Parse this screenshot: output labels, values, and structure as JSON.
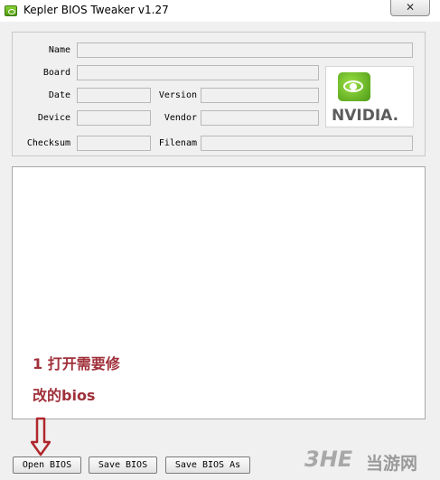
{
  "window": {
    "title": "Kepler BIOS Tweaker v1.27",
    "close_glyph": "✕"
  },
  "info": {
    "name_label": "Name",
    "board_label": "Board",
    "date_label": "Date",
    "version_label": "Version",
    "device_label": "Device",
    "vendor_label": "Vendor",
    "checksum_label": "Checksum",
    "filename_label": "Filenam",
    "name_value": "",
    "board_value": "",
    "date_value": "",
    "version_value": "",
    "device_value": "",
    "vendor_value": "",
    "checksum_value": "",
    "filename_value": ""
  },
  "logo": {
    "text": "NVIDIA.",
    "icon": "nvidia-eye-icon"
  },
  "annotation": {
    "line1": "1 打开需要修",
    "line2": "改的bios",
    "color": "#a0303a"
  },
  "buttons": {
    "open": "Open BIOS",
    "save": "Save BIOS",
    "save_as": "Save BIOS As"
  },
  "watermark": {
    "logo_text": "3HE",
    "site_text": "当游网"
  },
  "colors": {
    "accent_green": "#76b900",
    "window_bg": "#f0f0f0"
  }
}
